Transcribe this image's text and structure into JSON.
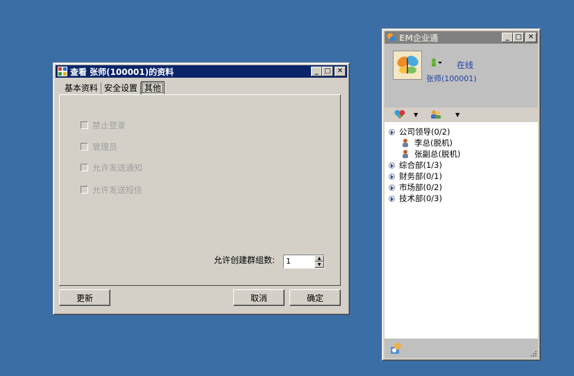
{
  "dialog": {
    "title": "查看 张师(100001)的资料",
    "tabs": [
      {
        "label": "基本资料",
        "active": false
      },
      {
        "label": "安全设置",
        "active": false
      },
      {
        "label": "其他",
        "active": true
      }
    ],
    "checkboxes": [
      {
        "label": "禁止登录",
        "checked": false,
        "enabled": false
      },
      {
        "label": "管理员",
        "checked": false,
        "enabled": false
      },
      {
        "label": "允许发送通知",
        "checked": false,
        "enabled": false
      },
      {
        "label": "允许发送短信",
        "checked": false,
        "enabled": false
      }
    ],
    "group_limit_label": "允许创建群组数:",
    "group_limit_value": "1",
    "buttons": {
      "update": "更新",
      "cancel": "取消",
      "ok": "确定"
    }
  },
  "im": {
    "title": "EM企业通",
    "status": "在线",
    "user": "张师(100001)",
    "tree": [
      {
        "label": "公司领导(0/2)",
        "type": "group"
      },
      {
        "label": "李总(脱机)",
        "type": "member"
      },
      {
        "label": "张副总(脱机)",
        "type": "member"
      },
      {
        "label": "综合部(1/3)",
        "type": "group"
      },
      {
        "label": "财务部(0/1)",
        "type": "group"
      },
      {
        "label": "市场部(0/2)",
        "type": "group"
      },
      {
        "label": "技术部(0/3)",
        "type": "group"
      }
    ]
  },
  "colors": {
    "desktop": "#3a6ea5",
    "active_title": "#0a246a",
    "inactive_title": "#808080",
    "link_text": "#2040a0"
  }
}
